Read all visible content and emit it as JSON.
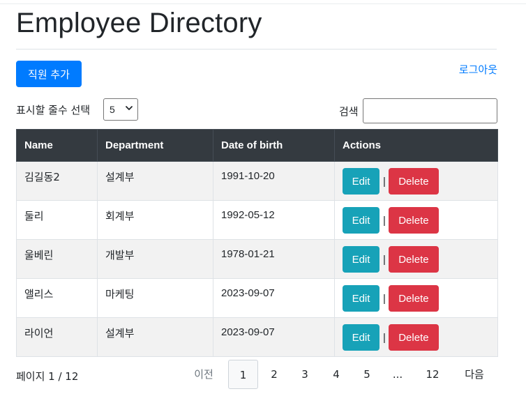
{
  "header": {
    "title": "Employee Directory"
  },
  "toolbar": {
    "add_label": "직원 추가",
    "logout_label": "로그아웃"
  },
  "controls": {
    "rows_label": "표시할 줄수 선택",
    "rows_value": "5",
    "search_label": "검색",
    "search_value": ""
  },
  "table": {
    "columns": [
      "Name",
      "Department",
      "Date of birth",
      "Actions"
    ],
    "rows": [
      {
        "name": "김길동2",
        "department": "설계부",
        "dob": "1991-10-20"
      },
      {
        "name": "둘리",
        "department": "회계부",
        "dob": "1992-05-12"
      },
      {
        "name": "울베린",
        "department": "개발부",
        "dob": "1978-01-21"
      },
      {
        "name": "앨리스",
        "department": "마케팅",
        "dob": "2023-09-07"
      },
      {
        "name": "라이언",
        "department": "설계부",
        "dob": "2023-09-07"
      }
    ],
    "edit_label": "Edit",
    "delete_label": "Delete",
    "separator": "|"
  },
  "pagination": {
    "info": "페이지 1 / 12",
    "prev": "이전",
    "pages": [
      "1",
      "2",
      "3",
      "4",
      "5",
      "...",
      "12"
    ],
    "current": "1",
    "next": "다음"
  },
  "colors": {
    "primary": "#007bff",
    "info": "#17a2b8",
    "danger": "#dc3545",
    "table_header": "#343a40",
    "row_stripe": "#f2f2f2"
  }
}
